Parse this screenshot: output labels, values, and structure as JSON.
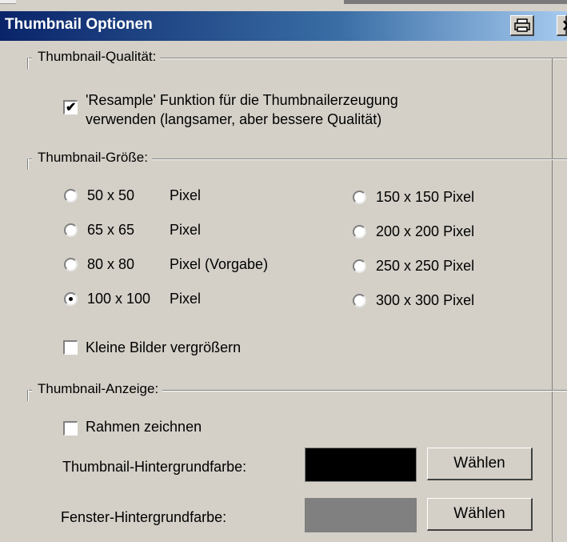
{
  "window": {
    "title": "Thumbnail Optionen"
  },
  "quality": {
    "legend": "Thumbnail-Qualität:",
    "resample_line1": "'Resample' Funktion für die Thumbnailerzeugung",
    "resample_line2": "verwenden (langsamer, aber bessere Qualität)",
    "resample_checked": true
  },
  "size": {
    "legend": "Thumbnail-Größe:",
    "options_left": [
      {
        "num": "50 x 50",
        "suffix": "Pixel"
      },
      {
        "num": "65 x 65",
        "suffix": "Pixel"
      },
      {
        "num": "80 x 80",
        "suffix": "Pixel (Vorgabe)"
      },
      {
        "num": "100 x 100",
        "suffix": "Pixel"
      }
    ],
    "options_right": [
      {
        "label": "150 x 150 Pixel"
      },
      {
        "label": "200 x 200 Pixel"
      },
      {
        "label": "250 x 250 Pixel"
      },
      {
        "label": "300 x 300 Pixel"
      }
    ],
    "selected": "100 x 100 Pixel",
    "enlarge_label": "Kleine Bilder vergrößern",
    "enlarge_checked": false
  },
  "display": {
    "legend": "Thumbnail-Anzeige:",
    "frame_label": "Rahmen zeichnen",
    "frame_checked": false,
    "thumb_bg_label": "Thumbnail-Hintergrundfarbe:",
    "thumb_bg_color": "#000000",
    "window_bg_label": "Fenster-Hintergrundfarbe:",
    "window_bg_color": "#808080",
    "choose_label": "Wählen",
    "choose_label_2": "Wählen"
  }
}
